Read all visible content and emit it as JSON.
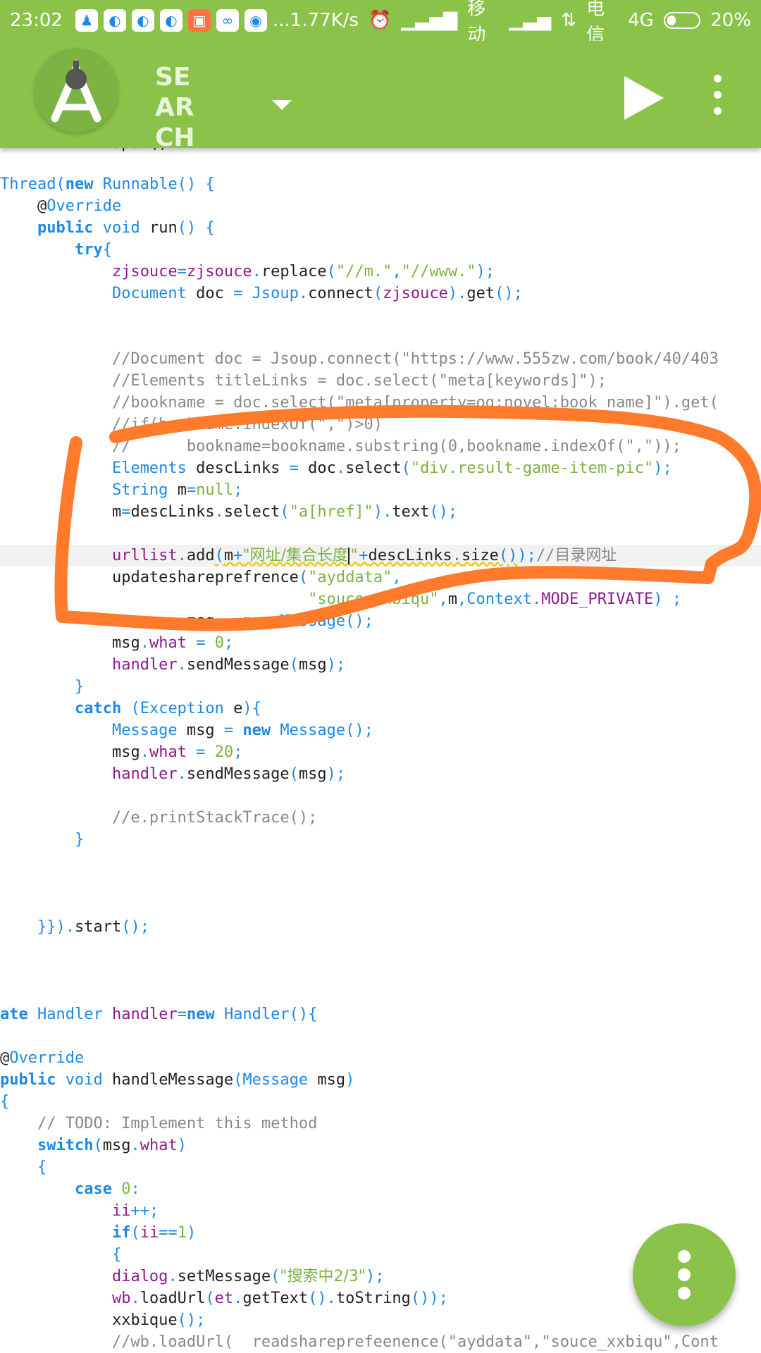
{
  "status_bar": {
    "time": "23:02",
    "more": "...",
    "net_speed": "1.77K/s",
    "carrier1": "移动",
    "carrier2": "电信",
    "network": "4G",
    "battery": "20%"
  },
  "toolbar": {
    "title": "SEARCH",
    "accent_color": "#8bc34a"
  },
  "code_lines": [
    "Thread(new Runnable() {",
    "    @Override",
    "    public void run() {",
    "        try{",
    "            zjsouce=zjsouce.replace(\"//m.\",\"//www.\");",
    "            Document doc = Jsoup.connect(zjsouce).get();",
    "            //Document doc = Jsoup.connect(\"https://www.555zw.com/book/40/403",
    "            //Elements titleLinks = doc.select(\"meta[keywords]\");",
    "            //bookname = doc.select(\"meta[property=og:novel:book_name]\").get(",
    "            //if(bookname.indexOf(\",\")>0)",
    "            //      bookname=bookname.substring(0,bookname.indexOf(\",\"));",
    "            Elements descLinks = doc.select(\"div.result-game-item-pic\");",
    "            String m=null;",
    "            m=descLinks.select(\"a[href]\").text();",
    "            urllist.add(m+\"网址/集合长度\"+descLinks.size());//目录网址",
    "            updateshareprefrence(\"ayddata\",",
    "                                 \"souce_xxbiqu\",m,Context.MODE_PRIVATE) ;",
    "            Message msg = new Message();",
    "            msg.what = 0;",
    "            handler.sendMessage(msg);",
    "        }",
    "        catch (Exception e){",
    "            Message msg = new Message();",
    "            msg.what = 20;",
    "            handler.sendMessage(msg);",
    "            //e.printStackTrace();",
    "        }",
    "    }}).start();",
    "ate Handler handler=new Handler(){",
    "@Override",
    "public void handleMessage(Message msg)",
    "{",
    "    // TODO: Implement this method",
    "    switch(msg.what)",
    "    {",
    "        case 0:",
    "            ii++;",
    "            if(ii==1)",
    "            {",
    "            dialog.setMessage(\"搜索中2/3\");",
    "            wb.loadUrl(et.getText().toString());",
    "            xxbique();",
    "            //wb.loadUrl(  readshareprefeenence(\"ayddata\",\"souce_xxbiqu\",Cont"
  ],
  "icons": {
    "run": "play-icon",
    "menu": "overflow-menu-icon",
    "fab": "more-vert-icon",
    "logo": "android-studio-logo"
  }
}
